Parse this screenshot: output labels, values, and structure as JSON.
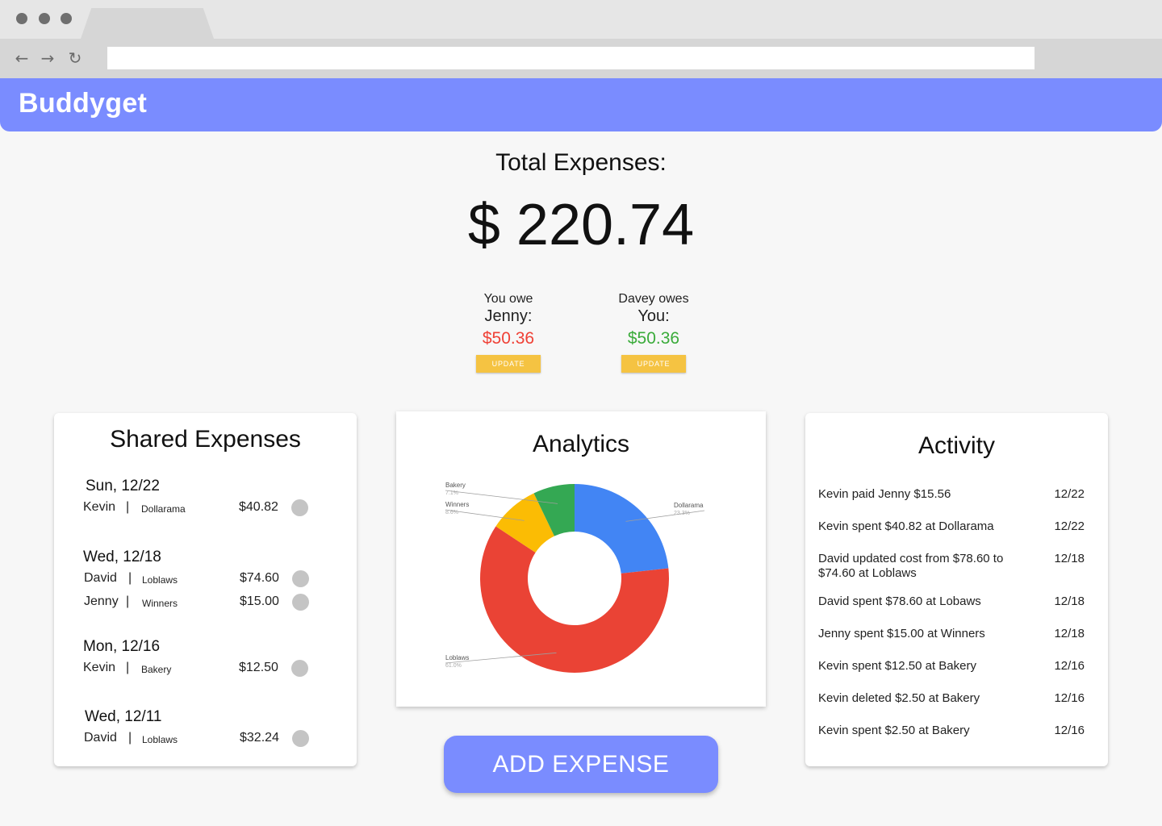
{
  "app": {
    "name": "Buddyget"
  },
  "totals": {
    "label": "Total Expenses:",
    "value": "$ 220.74"
  },
  "balances": [
    {
      "line1": "You owe",
      "line2": "Jenny:",
      "amount": "$50.36",
      "color": "#ef4136",
      "button": "UPDATE"
    },
    {
      "line1": "Davey owes",
      "line2": "You:",
      "amount": "$50.36",
      "color": "#3aab3a",
      "button": "UPDATE"
    }
  ],
  "shared": {
    "title": "Shared Expenses",
    "groups": [
      {
        "date": "Sun, 12/22",
        "rows": [
          {
            "who": "Kevin",
            "store": "Dollarama",
            "amount": "$40.82"
          }
        ]
      },
      {
        "date": "Wed, 12/18",
        "rows": [
          {
            "who": "David",
            "store": "Loblaws",
            "amount": "$74.60"
          },
          {
            "who": "Jenny",
            "store": "Winners",
            "amount": "$15.00"
          }
        ]
      },
      {
        "date": "Mon, 12/16",
        "rows": [
          {
            "who": "Kevin",
            "store": "Bakery",
            "amount": "$12.50"
          }
        ]
      },
      {
        "date": "Wed, 12/11",
        "rows": [
          {
            "who": "David",
            "store": "Loblaws",
            "amount": "$32.24"
          }
        ]
      }
    ]
  },
  "analytics": {
    "title": "Analytics"
  },
  "chart_data": {
    "type": "pie",
    "donut": true,
    "labels": [
      "Dollarama",
      "Loblaws",
      "Winners",
      "Bakery"
    ],
    "values": [
      23.3,
      61.0,
      8.6,
      7.1
    ],
    "value_labels": [
      "23.3%",
      "61.0%",
      "8.6%",
      "7.1%"
    ],
    "colors": [
      "#4285f4",
      "#ea4335",
      "#fbbc04",
      "#34a853"
    ]
  },
  "activity": {
    "title": "Activity",
    "items": [
      {
        "text": "Kevin paid Jenny $15.56",
        "date": "12/22"
      },
      {
        "text": "Kevin spent $40.82 at Dollarama",
        "date": "12/22"
      },
      {
        "text": "David updated cost from $78.60 to $74.60 at Loblaws",
        "date": "12/18"
      },
      {
        "text": "David spent $78.60 at Lobaws",
        "date": "12/18"
      },
      {
        "text": "Jenny spent $15.00 at Winners",
        "date": "12/18"
      },
      {
        "text": "Kevin spent $12.50 at Bakery",
        "date": "12/16"
      },
      {
        "text": "Kevin deleted $2.50 at Bakery",
        "date": "12/16"
      },
      {
        "text": "Kevin spent $2.50 at Bakery",
        "date": "12/16"
      }
    ]
  },
  "add_button": "ADD EXPENSE",
  "browser": {
    "nav_icons": [
      "back-arrow-icon",
      "forward-arrow-icon",
      "reload-icon"
    ]
  }
}
